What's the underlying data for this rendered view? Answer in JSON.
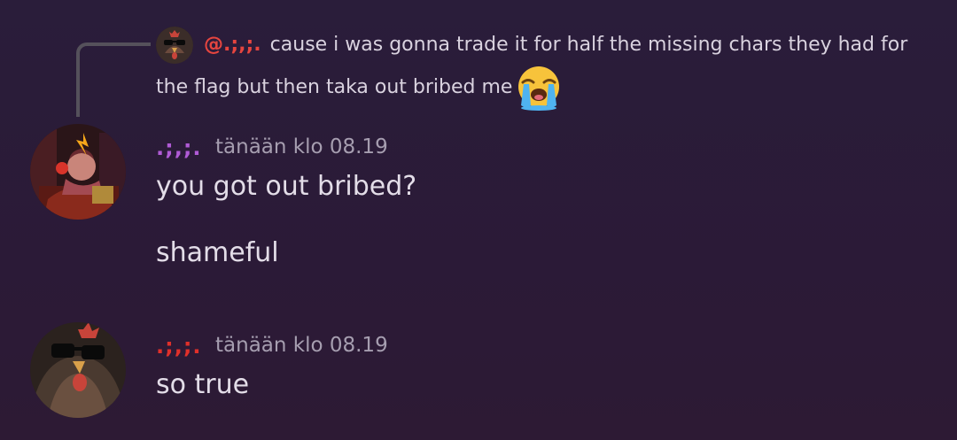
{
  "reply": {
    "mention": "@.;,;.",
    "text": "cause i was gonna trade it for half the missing chars they had for the flag but then taka out bribed me",
    "emoji": "loudly-crying-face"
  },
  "messages": [
    {
      "username": ".;,;.",
      "username_color": "#b05bd6",
      "timestamp": "tänään klo 08.19",
      "lines": [
        "you got out bribed?",
        "shameful"
      ]
    },
    {
      "username": ".;,;.",
      "username_color": "#e0302a",
      "timestamp": "tänään klo 08.19",
      "lines": [
        "so true"
      ]
    }
  ]
}
